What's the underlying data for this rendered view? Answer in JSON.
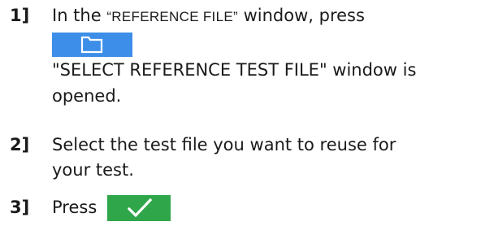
{
  "steps": [
    {
      "number": "1]",
      "line1_prefix": "In the ",
      "line1_quote": "“REFERENCE FILE”",
      "line1_suffix": " window, press",
      "button_icon": "folder-icon",
      "line2": "\"SELECT REFERENCE TEST FILE\" window is",
      "line3": "opened."
    },
    {
      "number": "2]",
      "line1": "Select the test file you want to reuse for",
      "line2": "your test."
    },
    {
      "number": "3]",
      "line1": "Press",
      "button_icon": "checkmark-icon"
    }
  ],
  "colors": {
    "folder_button": "#3d8ee8",
    "confirm_button": "#2fa64a"
  }
}
